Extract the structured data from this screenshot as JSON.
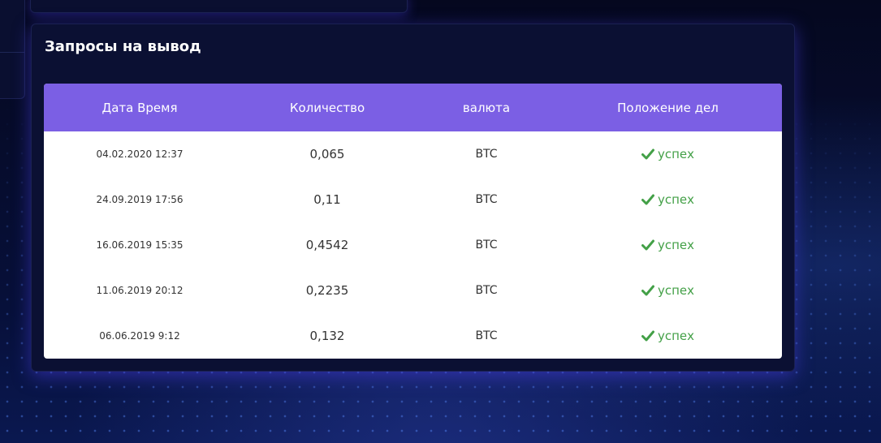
{
  "withdrawals": {
    "title": "Запросы на вывод",
    "columns": [
      "Дата Время",
      "Количество",
      "валюта",
      "Положение дел"
    ],
    "rows": [
      {
        "datetime": "04.02.2020 12:37",
        "amount": "0,065",
        "currency": "BTC",
        "status": "успех"
      },
      {
        "datetime": "24.09.2019 17:56",
        "amount": "0,11",
        "currency": "BTC",
        "status": "успех"
      },
      {
        "datetime": "16.06.2019 15:35",
        "amount": "0,4542",
        "currency": "BTC",
        "status": "успех"
      },
      {
        "datetime": "11.06.2019 20:12",
        "amount": "0,2235",
        "currency": "BTC",
        "status": "успех"
      },
      {
        "datetime": "06.06.2019 9:12",
        "amount": "0,132",
        "currency": "BTC",
        "status": "успех"
      }
    ],
    "status_icon": "check-icon",
    "colors": {
      "header": "#7b5fe4",
      "success": "#43a047",
      "panel": "#0b1033"
    }
  }
}
